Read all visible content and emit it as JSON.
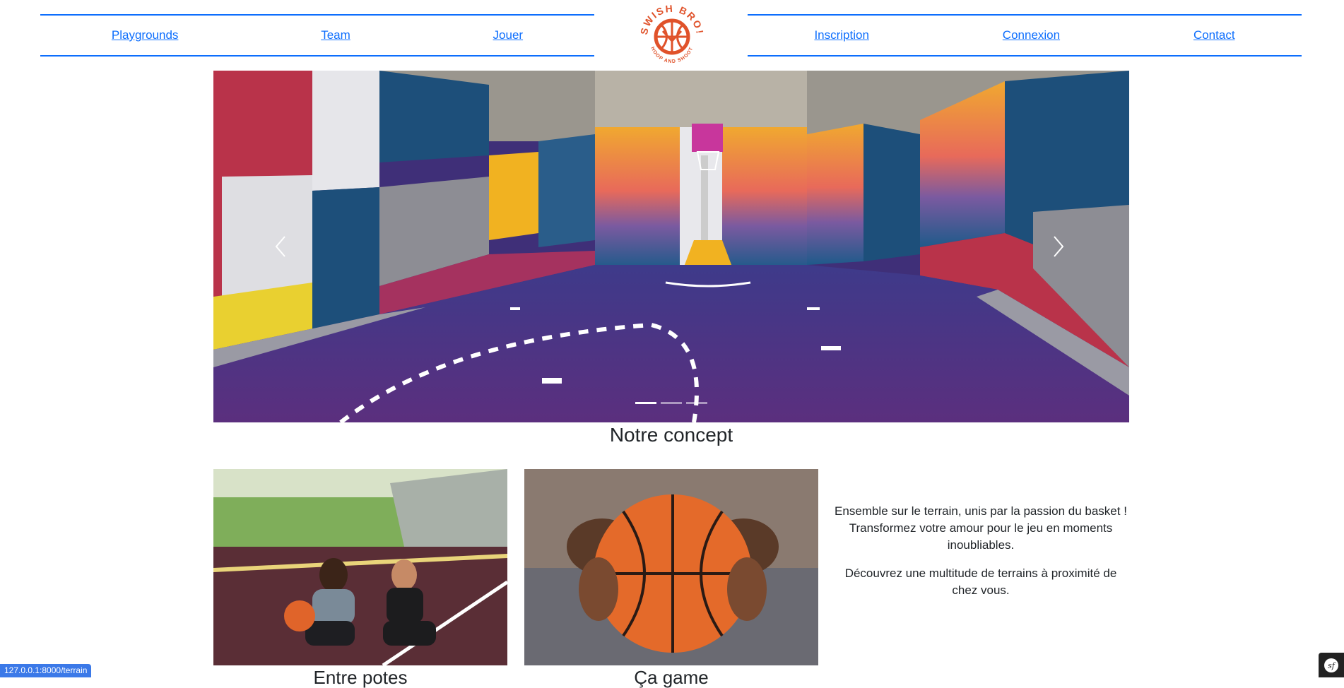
{
  "nav": {
    "left": [
      {
        "label": "Playgrounds"
      },
      {
        "label": "Team"
      },
      {
        "label": "Jouer"
      }
    ],
    "right": [
      {
        "label": "Inscription"
      },
      {
        "label": "Connexion"
      },
      {
        "label": "Contact"
      }
    ],
    "logo": {
      "text_top": "SWISH BRO!",
      "text_bottom": "HOOP AND SHOOT",
      "color": "#e0522a"
    }
  },
  "carousel": {
    "slides": 3,
    "active_slide": 1,
    "prev_icon": "chevron-left-icon",
    "next_icon": "chevron-right-icon"
  },
  "concept": {
    "title": "Notre concept",
    "paragraph1": "Ensemble sur le terrain, unis par la passion du basket ! Transformez votre amour pour le jeu en moments inoubliables.",
    "paragraph2": "Découvrez une multitude de terrains à proximité de chez vous."
  },
  "cards": [
    {
      "title": "Entre potes"
    },
    {
      "title": "Ça game"
    }
  ],
  "status_bar": {
    "url": "127.0.0.1:8000/terrain"
  },
  "colors": {
    "link": "#0d6efd",
    "brand_orange": "#e0522a",
    "court_purple": "#4b3a8c"
  }
}
